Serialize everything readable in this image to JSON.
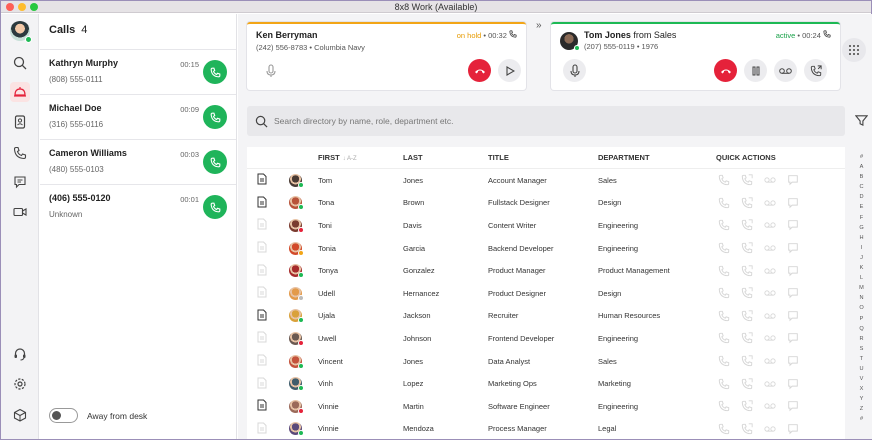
{
  "window": {
    "title": "8x8 Work (Available)"
  },
  "colors": {
    "brand_red": "#e5223a",
    "answer_green": "#1fb45a",
    "hold_orange": "#f2a516",
    "active_green": "#1db954"
  },
  "nav": [
    {
      "icon": "avatar-icon"
    },
    {
      "icon": "search-icon"
    },
    {
      "icon": "calls-bell-icon",
      "active": true
    },
    {
      "icon": "contacts-icon"
    },
    {
      "icon": "phone-icon"
    },
    {
      "icon": "chat-icon"
    },
    {
      "icon": "video-icon"
    },
    {
      "icon": "headset-icon"
    },
    {
      "icon": "settings-icon"
    },
    {
      "icon": "box-icon"
    }
  ],
  "calls": {
    "title": "Calls",
    "count": "4",
    "items": [
      {
        "name": "Kathryn Murphy",
        "sub": "(808) 555-0111",
        "time": "00:15"
      },
      {
        "name": "Michael Doe",
        "sub": "(316) 555-0116",
        "time": "00:09"
      },
      {
        "name": "Cameron Williams",
        "sub": "(480) 555-0103",
        "time": "00:03"
      },
      {
        "name": "(406) 555-0120",
        "sub": "Unknown",
        "time": "00:01"
      }
    ],
    "away_label": "Away from desk"
  },
  "hold_call": {
    "name": "Ken Berryman",
    "sub": "(242) 556-8783 • Columbia Navy",
    "status": "on hold",
    "time": "• 00:32"
  },
  "active_call": {
    "name": "Tom Jones",
    "name_suffix": " from Sales",
    "sub": "(207) 555-0119 • 1976",
    "status": "active",
    "time": "• 00:24"
  },
  "search": {
    "placeholder": "Search directory by name, role, department etc."
  },
  "table": {
    "headers": {
      "first": "FIRST",
      "first_sort": "A-Z",
      "last": "LAST",
      "title": "TITLE",
      "department": "DEPARTMENT",
      "quick_actions": "QUICK ACTIONS"
    },
    "rows": [
      {
        "first": "Tom",
        "last": "Jones",
        "title": "Account Manager",
        "department": "Sales",
        "doc": true,
        "status": "#1db954",
        "avatar": "#4a3b34"
      },
      {
        "first": "Tona",
        "last": "Brown",
        "title": "Fullstack Designer",
        "department": "Design",
        "doc": true,
        "status": "#1db954",
        "avatar": "#b8543a"
      },
      {
        "first": "Toni",
        "last": "Davis",
        "title": "Content Writer",
        "department": "Engineering",
        "doc": false,
        "status": "#e5223a",
        "avatar": "#7a3b2f"
      },
      {
        "first": "Tonia",
        "last": "Garcia",
        "title": "Backend Developer",
        "department": "Engineering",
        "doc": false,
        "status": "#f2a516",
        "avatar": "#d24a2a"
      },
      {
        "first": "Tonya",
        "last": "Gonzalez",
        "title": "Product Manager",
        "department": "Product Management",
        "doc": false,
        "status": "#1db954",
        "avatar": "#a62b2b"
      },
      {
        "first": "Udell",
        "last": "Hernancez",
        "title": "Product Designer",
        "department": "Design",
        "doc": false,
        "status": "#bbbbbb",
        "avatar": "#e39a4a"
      },
      {
        "first": "Ujala",
        "last": "Jackson",
        "title": "Recruiter",
        "department": "Human Resources",
        "doc": true,
        "status": "#1db954",
        "avatar": "#d9a13a"
      },
      {
        "first": "Uwell",
        "last": "Johnson",
        "title": "Frontend Developer",
        "department": "Engineering",
        "doc": false,
        "status": "#e5223a",
        "avatar": "#6b5a52"
      },
      {
        "first": "Vincent",
        "last": "Jones",
        "title": "Data Analyst",
        "department": "Sales",
        "doc": false,
        "status": "#1db954",
        "avatar": "#c4533c"
      },
      {
        "first": "Vinh",
        "last": "Lopez",
        "title": "Marketing Ops",
        "department": "Marketing",
        "doc": false,
        "status": "#1db954",
        "avatar": "#3f5c6b"
      },
      {
        "first": "Vinnie",
        "last": "Martin",
        "title": "Software Engineer",
        "department": "Engineering",
        "doc": true,
        "status": "#e5223a",
        "avatar": "#9b6a5a"
      },
      {
        "first": "Vinnie",
        "last": "Mendoza",
        "title": "Process Manager",
        "department": "Legal",
        "doc": false,
        "status": "#1db954",
        "avatar": "#5b4a7a"
      }
    ]
  },
  "alphabet": [
    "#",
    "A",
    "B",
    "C",
    "D",
    "E",
    "F",
    "G",
    "H",
    "I",
    "J",
    "K",
    "L",
    "M",
    "N",
    "O",
    "P",
    "Q",
    "R",
    "S",
    "T",
    "U",
    "V",
    "X",
    "Y",
    "Z",
    "#"
  ]
}
